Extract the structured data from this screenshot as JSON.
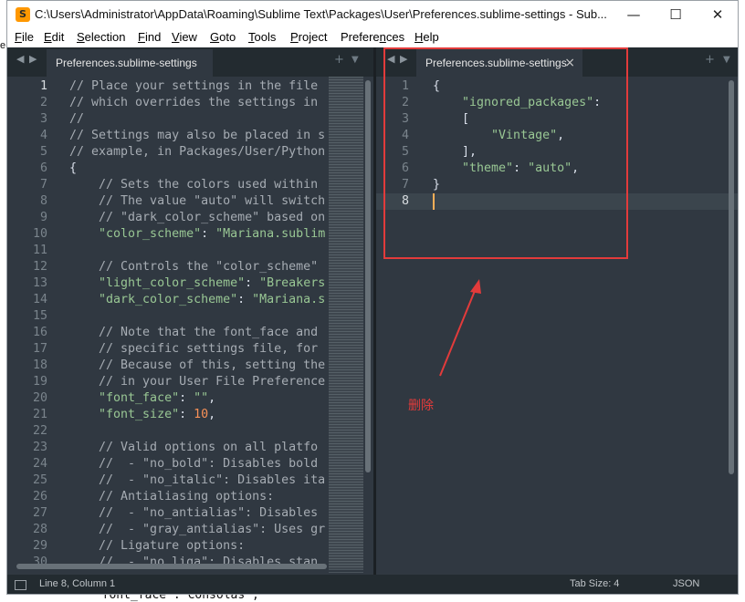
{
  "window": {
    "title": "C:\\Users\\Administrator\\AppData\\Roaming\\Sublime Text\\Packages\\User\\Preferences.sublime-settings - Sub...",
    "controls": {
      "minimize": "—",
      "maximize": "☐",
      "close": "✕"
    }
  },
  "menu": [
    {
      "label": "File",
      "underline": "F",
      "rest": "ile"
    },
    {
      "label": "Edit",
      "underline": "E",
      "rest": "dit"
    },
    {
      "label": "Selection",
      "underline": "S",
      "rest": "election"
    },
    {
      "label": "Find",
      "underline": "F",
      "rest": "ind"
    },
    {
      "label": "View",
      "underline": "V",
      "rest": "iew"
    },
    {
      "label": "Goto",
      "underline": "G",
      "rest": "oto"
    },
    {
      "label": "Tools",
      "underline": "T",
      "rest": "ools"
    },
    {
      "label": "Project",
      "underline": "P",
      "rest": "roject"
    },
    {
      "label": "Preferences",
      "underline": "n",
      "rest": ""
    },
    {
      "label": "Help",
      "underline": "H",
      "rest": "elp"
    }
  ],
  "left_pane": {
    "tab_label": "Preferences.sublime-settings",
    "lines": [
      {
        "n": "1",
        "parts": [
          [
            "c-comment",
            "// Place your settings in the file"
          ]
        ]
      },
      {
        "n": "2",
        "parts": [
          [
            "c-comment",
            "// which overrides the settings in"
          ]
        ]
      },
      {
        "n": "3",
        "parts": [
          [
            "c-comment",
            "//"
          ]
        ]
      },
      {
        "n": "4",
        "parts": [
          [
            "c-comment",
            "// Settings may also be placed in s"
          ]
        ]
      },
      {
        "n": "5",
        "parts": [
          [
            "c-comment",
            "// example, in Packages/User/Python"
          ]
        ]
      },
      {
        "n": "6",
        "parts": [
          [
            "c-punct",
            "{"
          ]
        ]
      },
      {
        "n": "7",
        "parts": [
          [
            "c-comment",
            "    // Sets the colors used within"
          ]
        ]
      },
      {
        "n": "8",
        "parts": [
          [
            "c-comment",
            "    // The value \"auto\" will switch"
          ]
        ]
      },
      {
        "n": "9",
        "parts": [
          [
            "c-comment",
            "    // \"dark_color_scheme\" based on"
          ]
        ]
      },
      {
        "n": "10",
        "parts": [
          [
            "c-key",
            "    \"color_scheme\""
          ],
          [
            "c-punct",
            ": "
          ],
          [
            "c-string",
            "\"Mariana.sublim"
          ]
        ]
      },
      {
        "n": "11",
        "parts": [
          [
            "c-punct",
            ""
          ]
        ]
      },
      {
        "n": "12",
        "parts": [
          [
            "c-comment",
            "    // Controls the \"color_scheme\""
          ]
        ]
      },
      {
        "n": "13",
        "parts": [
          [
            "c-key",
            "    \"light_color_scheme\""
          ],
          [
            "c-punct",
            ": "
          ],
          [
            "c-string",
            "\"Breakers"
          ]
        ]
      },
      {
        "n": "14",
        "parts": [
          [
            "c-key",
            "    \"dark_color_scheme\""
          ],
          [
            "c-punct",
            ": "
          ],
          [
            "c-string",
            "\"Mariana.s"
          ]
        ]
      },
      {
        "n": "15",
        "parts": [
          [
            "c-punct",
            ""
          ]
        ]
      },
      {
        "n": "16",
        "parts": [
          [
            "c-comment",
            "    // Note that the font_face and"
          ]
        ]
      },
      {
        "n": "17",
        "parts": [
          [
            "c-comment",
            "    // specific settings file, for"
          ]
        ]
      },
      {
        "n": "18",
        "parts": [
          [
            "c-comment",
            "    // Because of this, setting the"
          ]
        ]
      },
      {
        "n": "19",
        "parts": [
          [
            "c-comment",
            "    // in your User File Preference"
          ]
        ]
      },
      {
        "n": "20",
        "parts": [
          [
            "c-key",
            "    \"font_face\""
          ],
          [
            "c-punct",
            ": "
          ],
          [
            "c-string",
            "\"\""
          ],
          [
            "c-punct",
            ","
          ]
        ]
      },
      {
        "n": "21",
        "parts": [
          [
            "c-key",
            "    \"font_size\""
          ],
          [
            "c-punct",
            ": "
          ],
          [
            "c-num",
            "10"
          ],
          [
            "c-punct",
            ","
          ]
        ]
      },
      {
        "n": "22",
        "parts": [
          [
            "c-punct",
            ""
          ]
        ]
      },
      {
        "n": "23",
        "parts": [
          [
            "c-comment",
            "    // Valid options on all platfo"
          ]
        ]
      },
      {
        "n": "24",
        "parts": [
          [
            "c-comment",
            "    //  - \"no_bold\": Disables bold"
          ]
        ]
      },
      {
        "n": "25",
        "parts": [
          [
            "c-comment",
            "    //  - \"no_italic\": Disables ita"
          ]
        ]
      },
      {
        "n": "26",
        "parts": [
          [
            "c-comment",
            "    // Antialiasing options:"
          ]
        ]
      },
      {
        "n": "27",
        "parts": [
          [
            "c-comment",
            "    //  - \"no_antialias\": Disables"
          ]
        ]
      },
      {
        "n": "28",
        "parts": [
          [
            "c-comment",
            "    //  - \"gray_antialias\": Uses gr"
          ]
        ]
      },
      {
        "n": "29",
        "parts": [
          [
            "c-comment",
            "    // Ligature options:"
          ]
        ]
      },
      {
        "n": "30",
        "parts": [
          [
            "c-comment",
            "    //  - \"no_liga\": Disables stan"
          ]
        ]
      }
    ]
  },
  "right_pane": {
    "tab_label": "Preferences.sublime-settings",
    "lines": [
      {
        "n": "1",
        "parts": [
          [
            "c-punct",
            "{"
          ]
        ]
      },
      {
        "n": "2",
        "parts": [
          [
            "c-key",
            "    \"ignored_packages\""
          ],
          [
            "c-punct",
            ":"
          ]
        ]
      },
      {
        "n": "3",
        "parts": [
          [
            "c-punct",
            "    ["
          ]
        ]
      },
      {
        "n": "4",
        "parts": [
          [
            "c-string",
            "        \"Vintage\""
          ],
          [
            "c-punct",
            ","
          ]
        ]
      },
      {
        "n": "5",
        "parts": [
          [
            "c-punct",
            "    ],"
          ]
        ]
      },
      {
        "n": "6",
        "parts": [
          [
            "c-key",
            "    \"theme\""
          ],
          [
            "c-punct",
            ": "
          ],
          [
            "c-string",
            "\"auto\""
          ],
          [
            "c-punct",
            ","
          ]
        ]
      },
      {
        "n": "7",
        "parts": [
          [
            "c-punct",
            "}"
          ]
        ]
      },
      {
        "n": "8",
        "parts": [
          [
            "c-punct",
            ""
          ]
        ]
      }
    ],
    "active_line": "8"
  },
  "icons": {
    "tab_close": "×",
    "nav_left": "◀",
    "nav_right": "▶",
    "new_tab": "+",
    "tab_menu": "▼"
  },
  "status": {
    "position": "Line 8, Column 1",
    "tab_size": "Tab Size: 4",
    "syntax": "JSON"
  },
  "annotation": {
    "label": "删除",
    "color": "#e23b3b"
  },
  "background_text": {
    "bottom_line": "  font_face : Consolas ,",
    "left_edge": "e"
  },
  "colors": {
    "editor_bg": "#303841",
    "tabbar_bg": "#232b30",
    "comment": "#a6acb3",
    "string": "#99c794",
    "number": "#f99157",
    "cursor": "#f9ae58"
  }
}
